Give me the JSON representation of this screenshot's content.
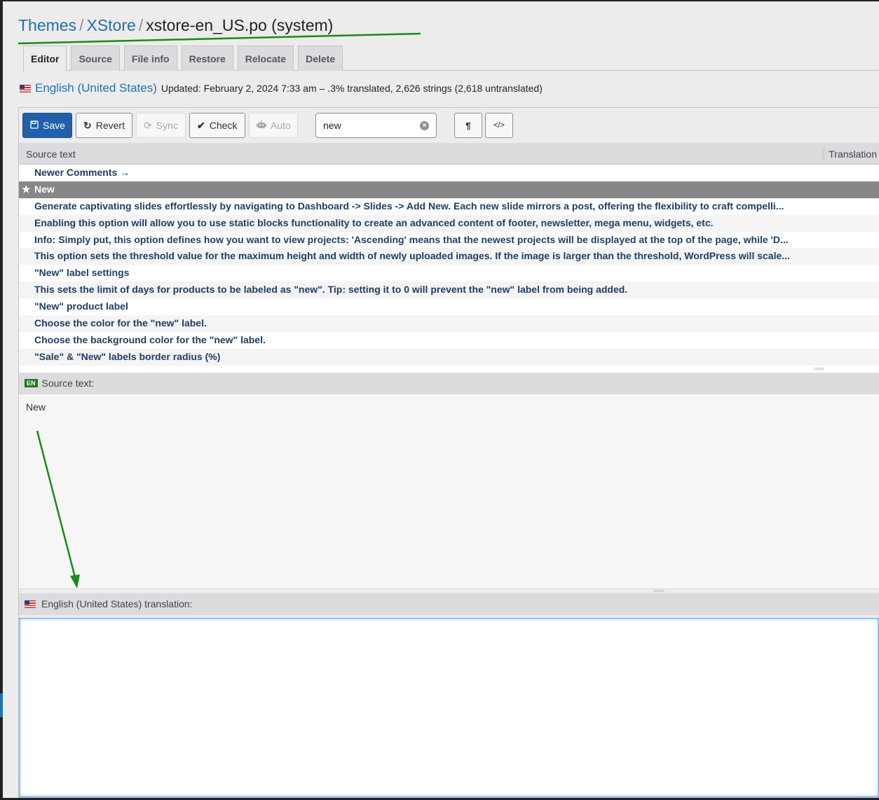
{
  "breadcrumb": {
    "items": [
      "Themes",
      "XStore"
    ],
    "separator": "/",
    "current": "xstore-en_US.po (system)"
  },
  "tabs": [
    {
      "label": "Editor",
      "active": true
    },
    {
      "label": "Source",
      "active": false
    },
    {
      "label": "File info",
      "active": false
    },
    {
      "label": "Restore",
      "active": false
    },
    {
      "label": "Relocate",
      "active": false
    },
    {
      "label": "Delete",
      "active": false
    }
  ],
  "meta": {
    "language": "English (United States)",
    "status": "Updated: February 2, 2024 7:33 am – .3% translated, 2,626 strings (2,618 untranslated)"
  },
  "toolbar": {
    "save": "Save",
    "revert": "Revert",
    "sync": "Sync",
    "check": "Check",
    "auto": "Auto",
    "search_value": "new",
    "clear_icon": "×",
    "pilcrow": "¶",
    "code": "</>"
  },
  "list": {
    "headers": {
      "source": "Source text",
      "translation": "Translation"
    },
    "rows": [
      "Newer Comments →",
      "New",
      "Generate captivating slides effortlessly by navigating to Dashboard -> Slides -> Add New. Each new slide mirrors a post, offering the flexibility to craft compelli...",
      "Enabling this option will allow you to use static blocks functionality to create an advanced content of footer, newsletter, mega menu, widgets, etc.",
      "Info: Simply put, this option defines how you want to view projects: 'Ascending' means that the newest projects will be displayed at the top of the page, while 'D...",
      "This option sets the threshold value for the maximum height and width of newly uploaded images. If the image is larger than the threshold, WordPress will scale...",
      "\"New\" label settings",
      "This sets the limit of days for products to be labeled as \"new\". Tip: setting it to 0 will prevent the \"new\" label from being added.",
      "\"New\" product label",
      "Choose the color for the \"new\" label.",
      "Choose the background color for the \"new\" label.",
      "\"Sale\" & \"New\" labels border radius (%)"
    ],
    "selected_index": 1
  },
  "source_pane": {
    "badge": "EN",
    "label": "Source text:",
    "text": "New"
  },
  "translation_pane": {
    "label": "English (United States) translation:",
    "value": ""
  },
  "colors": {
    "accent": "#2271b1",
    "primary_button": "#2160a8",
    "selected_row": "#878787",
    "annotation": "#1a8a1a"
  }
}
